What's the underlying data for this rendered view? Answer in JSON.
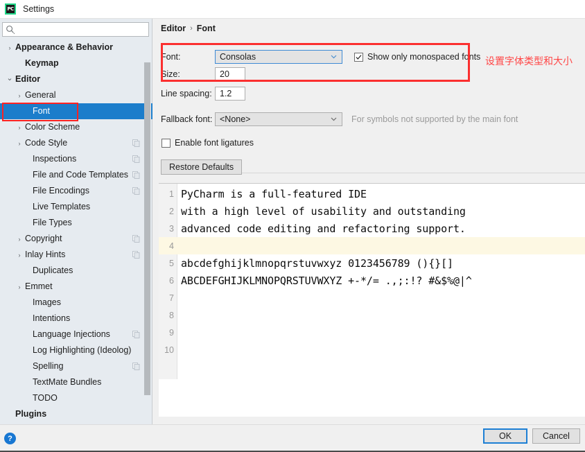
{
  "window": {
    "title": "Settings",
    "app_icon": "pycharm-icon",
    "accent_blue": "#1b7dcb",
    "annotation_red": "#fb2f2f"
  },
  "search": {
    "value": "",
    "placeholder": "",
    "icon": "search-icon"
  },
  "sidebar": {
    "items": [
      {
        "label": "Appearance & Behavior",
        "arrow": "›",
        "bold": true,
        "indent": 8,
        "copy": false,
        "selected": false
      },
      {
        "label": "Keymap",
        "arrow": "",
        "bold": true,
        "indent": 22,
        "copy": false,
        "selected": false
      },
      {
        "label": "Editor",
        "arrow": "⌄",
        "bold": true,
        "indent": 8,
        "copy": false,
        "selected": false
      },
      {
        "label": "General",
        "arrow": "›",
        "bold": false,
        "indent": 22,
        "copy": false,
        "selected": false
      },
      {
        "label": "Font",
        "arrow": "",
        "bold": false,
        "indent": 33,
        "copy": false,
        "selected": true
      },
      {
        "label": "Color Scheme",
        "arrow": "›",
        "bold": false,
        "indent": 22,
        "copy": false,
        "selected": false
      },
      {
        "label": "Code Style",
        "arrow": "›",
        "bold": false,
        "indent": 22,
        "copy": true,
        "selected": false
      },
      {
        "label": "Inspections",
        "arrow": "",
        "bold": false,
        "indent": 33,
        "copy": true,
        "selected": false
      },
      {
        "label": "File and Code Templates",
        "arrow": "",
        "bold": false,
        "indent": 33,
        "copy": true,
        "selected": false
      },
      {
        "label": "File Encodings",
        "arrow": "",
        "bold": false,
        "indent": 33,
        "copy": true,
        "selected": false
      },
      {
        "label": "Live Templates",
        "arrow": "",
        "bold": false,
        "indent": 33,
        "copy": false,
        "selected": false
      },
      {
        "label": "File Types",
        "arrow": "",
        "bold": false,
        "indent": 33,
        "copy": false,
        "selected": false
      },
      {
        "label": "Copyright",
        "arrow": "›",
        "bold": false,
        "indent": 22,
        "copy": true,
        "selected": false
      },
      {
        "label": "Inlay Hints",
        "arrow": "›",
        "bold": false,
        "indent": 22,
        "copy": true,
        "selected": false
      },
      {
        "label": "Duplicates",
        "arrow": "",
        "bold": false,
        "indent": 33,
        "copy": false,
        "selected": false
      },
      {
        "label": "Emmet",
        "arrow": "›",
        "bold": false,
        "indent": 22,
        "copy": false,
        "selected": false
      },
      {
        "label": "Images",
        "arrow": "",
        "bold": false,
        "indent": 33,
        "copy": false,
        "selected": false
      },
      {
        "label": "Intentions",
        "arrow": "",
        "bold": false,
        "indent": 33,
        "copy": false,
        "selected": false
      },
      {
        "label": "Language Injections",
        "arrow": "",
        "bold": false,
        "indent": 33,
        "copy": true,
        "selected": false
      },
      {
        "label": "Log Highlighting (Ideolog)",
        "arrow": "",
        "bold": false,
        "indent": 33,
        "copy": false,
        "selected": false
      },
      {
        "label": "Spelling",
        "arrow": "",
        "bold": false,
        "indent": 33,
        "copy": true,
        "selected": false
      },
      {
        "label": "TextMate Bundles",
        "arrow": "",
        "bold": false,
        "indent": 33,
        "copy": false,
        "selected": false
      },
      {
        "label": "TODO",
        "arrow": "",
        "bold": false,
        "indent": 33,
        "copy": false,
        "selected": false
      },
      {
        "label": "Plugins",
        "arrow": "",
        "bold": true,
        "indent": 8,
        "copy": false,
        "selected": false
      }
    ]
  },
  "breadcrumb": {
    "parent": "Editor",
    "separator": "›",
    "current": "Font"
  },
  "form": {
    "font_label": "Font:",
    "font_value": "Consolas",
    "size_label": "Size:",
    "size_value": "20",
    "line_spacing_label": "Line spacing:",
    "line_spacing_value": "1.2",
    "show_monospaced_label": "Show only monospaced fonts",
    "show_monospaced_checked": true,
    "fallback_label": "Fallback font:",
    "fallback_value": "<None>",
    "fallback_hint": "For symbols not supported by the main font",
    "ligatures_label": "Enable font ligatures",
    "ligatures_checked": false,
    "restore_defaults_label": "Restore Defaults"
  },
  "annotation": {
    "text": "设置字体类型和大小"
  },
  "preview": {
    "lines": [
      {
        "num": "1",
        "text": "PyCharm is a full-featured IDE",
        "caret": false
      },
      {
        "num": "2",
        "text": "with a high level of usability and outstanding",
        "caret": false
      },
      {
        "num": "3",
        "text": "advanced code editing and refactoring support.",
        "caret": false
      },
      {
        "num": "4",
        "text": "",
        "caret": true
      },
      {
        "num": "5",
        "text": "abcdefghijklmnopqrstuvwxyz 0123456789 (){}[]",
        "caret": false
      },
      {
        "num": "6",
        "text": "ABCDEFGHIJKLMNOPQRSTUVWXYZ +-*/= .,;:!? #&$%@|^",
        "caret": false
      },
      {
        "num": "7",
        "text": "",
        "caret": false
      },
      {
        "num": "8",
        "text": "",
        "caret": false
      },
      {
        "num": "9",
        "text": "",
        "caret": false
      },
      {
        "num": "10",
        "text": "",
        "caret": false
      }
    ]
  },
  "footer": {
    "help_label": "?",
    "ok_label": "OK",
    "cancel_label": "Cancel"
  }
}
